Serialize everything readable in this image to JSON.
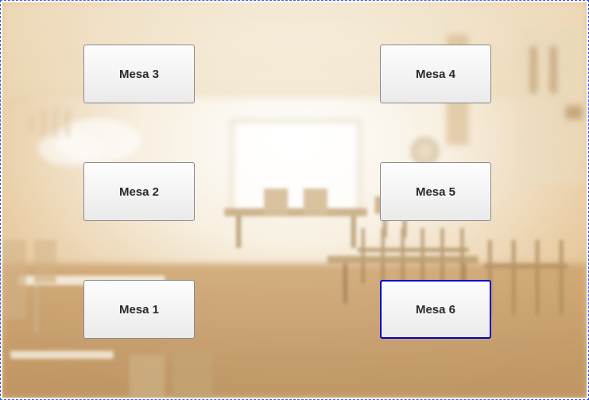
{
  "tables": {
    "left_top": {
      "label": "Mesa 3",
      "selected": false
    },
    "left_mid": {
      "label": "Mesa 2",
      "selected": false
    },
    "left_bot": {
      "label": "Mesa 1",
      "selected": false
    },
    "right_top": {
      "label": "Mesa 4",
      "selected": false
    },
    "right_mid": {
      "label": "Mesa 5",
      "selected": false
    },
    "right_bot": {
      "label": "Mesa 6",
      "selected": true
    }
  }
}
